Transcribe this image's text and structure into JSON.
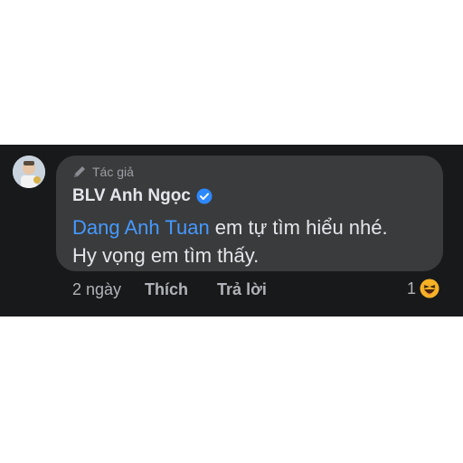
{
  "comment": {
    "badge_label": "Tác giả",
    "author_name": "BLV Anh Ngọc",
    "verified_icon": "verified-badge-icon",
    "mention": "Dang Anh Tuan",
    "text_after_mention": " em tự tìm hiểu nhé.",
    "text_line2": "Hy vọng em tìm thấy.",
    "time": "2 ngày",
    "like_label": "Thích",
    "reply_label": "Trả lời",
    "reaction_count": "1",
    "reaction_icon": "haha-emoji-icon"
  },
  "colors": {
    "background": "#18191a",
    "bubble": "#3a3b3c",
    "mention": "#4599ff",
    "verified": "#2d88ff",
    "text_primary": "#e4e6eb",
    "text_secondary": "#b0b3b8"
  }
}
